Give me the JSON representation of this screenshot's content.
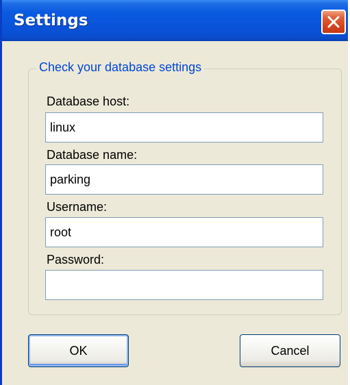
{
  "window": {
    "title": "Settings"
  },
  "group": {
    "title": "Check your database settings"
  },
  "fields": {
    "host": {
      "label": "Database host:",
      "value": "linux"
    },
    "name": {
      "label": "Database name:",
      "value": "parking"
    },
    "username": {
      "label": "Username:",
      "value": "root"
    },
    "password": {
      "label": "Password:",
      "value": ""
    }
  },
  "buttons": {
    "ok": "OK",
    "cancel": "Cancel"
  },
  "colors": {
    "titlebar": "#0a52d8",
    "close": "#d4421c",
    "group_title": "#0046d5",
    "background": "#ece9d8"
  },
  "icons": {
    "close": "close-icon"
  }
}
